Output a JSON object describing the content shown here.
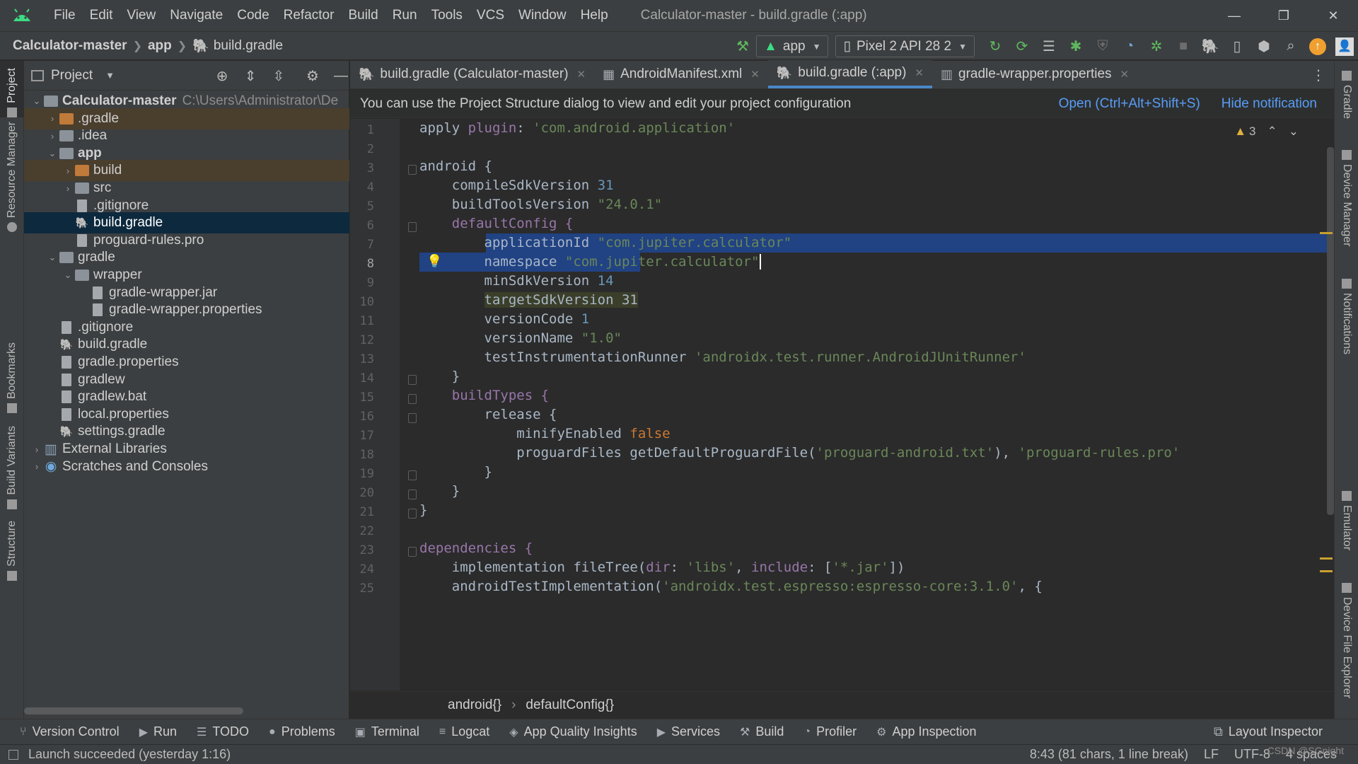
{
  "menu": {
    "items": [
      "File",
      "Edit",
      "View",
      "Navigate",
      "Code",
      "Refactor",
      "Build",
      "Run",
      "Tools",
      "VCS",
      "Window",
      "Help"
    ],
    "window_title": "Calculator-master - build.gradle (:app)"
  },
  "nav": {
    "crumb_project": "Calculator-master",
    "crumb_module": "app",
    "crumb_file": "build.gradle",
    "run_config": "app",
    "device": "Pixel 2 API 28 2"
  },
  "left_strip": {
    "project": "Project",
    "resource_manager": "Resource Manager",
    "bookmarks": "Bookmarks",
    "build_variants": "Build Variants",
    "structure": "Structure"
  },
  "right_strip": {
    "gradle": "Gradle",
    "device_manager": "Device Manager",
    "notifications": "Notifications",
    "emulator": "Emulator",
    "device_file_explorer": "Device File Explorer"
  },
  "project_panel": {
    "title": "Project",
    "root_path": "C:\\Users\\Administrator\\De",
    "tree": [
      {
        "label": "Calculator-master",
        "depth": 0,
        "expanded": true,
        "type": "module",
        "bold": true
      },
      {
        "label": ".gradle",
        "depth": 1,
        "expanded": false,
        "type": "folder-orange",
        "excluded": true
      },
      {
        "label": ".idea",
        "depth": 1,
        "expanded": false,
        "type": "folder"
      },
      {
        "label": "app",
        "depth": 1,
        "expanded": true,
        "type": "module",
        "bold": true
      },
      {
        "label": "build",
        "depth": 2,
        "expanded": false,
        "type": "folder-orange",
        "excluded": true
      },
      {
        "label": "src",
        "depth": 2,
        "expanded": false,
        "type": "folder"
      },
      {
        "label": ".gitignore",
        "depth": 2,
        "type": "file"
      },
      {
        "label": "build.gradle",
        "depth": 2,
        "type": "gradle",
        "selected": true
      },
      {
        "label": "proguard-rules.pro",
        "depth": 2,
        "type": "file"
      },
      {
        "label": "gradle",
        "depth": 1,
        "expanded": true,
        "type": "folder"
      },
      {
        "label": "wrapper",
        "depth": 2,
        "expanded": true,
        "type": "folder"
      },
      {
        "label": "gradle-wrapper.jar",
        "depth": 3,
        "type": "file"
      },
      {
        "label": "gradle-wrapper.properties",
        "depth": 3,
        "type": "file"
      },
      {
        "label": ".gitignore",
        "depth": 1,
        "type": "file"
      },
      {
        "label": "build.gradle",
        "depth": 1,
        "type": "gradle"
      },
      {
        "label": "gradle.properties",
        "depth": 1,
        "type": "file"
      },
      {
        "label": "gradlew",
        "depth": 1,
        "type": "file"
      },
      {
        "label": "gradlew.bat",
        "depth": 1,
        "type": "file"
      },
      {
        "label": "local.properties",
        "depth": 1,
        "type": "file"
      },
      {
        "label": "settings.gradle",
        "depth": 1,
        "type": "gradle"
      },
      {
        "label": "External Libraries",
        "depth": 0,
        "expanded": false,
        "type": "libs"
      },
      {
        "label": "Scratches and Consoles",
        "depth": 0,
        "expanded": false,
        "type": "scratch"
      }
    ]
  },
  "tabs": [
    {
      "label": "build.gradle (Calculator-master)",
      "active": false
    },
    {
      "label": "AndroidManifest.xml",
      "active": false
    },
    {
      "label": "build.gradle (:app)",
      "active": true
    },
    {
      "label": "gradle-wrapper.properties",
      "active": false
    }
  ],
  "banner": {
    "message": "You can use the Project Structure dialog to view and edit your project configuration",
    "open_link": "Open (Ctrl+Alt+Shift+S)",
    "hide_link": "Hide notification"
  },
  "editor": {
    "warning_count": "3",
    "current_line": 8,
    "lines": [
      [
        [
          "apply ",
          "fn"
        ],
        [
          "plugin",
          "p"
        ],
        [
          ": ",
          "fn"
        ],
        [
          "'com.android.application'",
          "s"
        ]
      ],
      [],
      [
        [
          "android {",
          "fn"
        ]
      ],
      [
        [
          "    compileSdkVersion ",
          "fn"
        ],
        [
          "31",
          "n"
        ]
      ],
      [
        [
          "    buildToolsVersion ",
          "fn"
        ],
        [
          "\"24.0.1\"",
          "s"
        ]
      ],
      [
        [
          "    defaultConfig {",
          "p"
        ]
      ],
      [
        [
          "        applicationId ",
          "fn"
        ],
        [
          "\"com.jupiter.calculator\"",
          "s"
        ]
      ],
      [
        [
          "        namespace ",
          "fn"
        ],
        [
          "\"com.jupiter.calculator\"",
          "s"
        ]
      ],
      [
        [
          "        minSdkVersion ",
          "fn"
        ],
        [
          "14",
          "n"
        ]
      ],
      [
        [
          "        ",
          "fn"
        ],
        [
          "targetSdkVersion 31",
          "targ"
        ]
      ],
      [
        [
          "        versionCode ",
          "fn"
        ],
        [
          "1",
          "n"
        ]
      ],
      [
        [
          "        versionName ",
          "fn"
        ],
        [
          "\"1.0\"",
          "s"
        ]
      ],
      [
        [
          "        testInstrumentationRunner ",
          "fn"
        ],
        [
          "'androidx.test.runner.AndroidJUnitRunner'",
          "s"
        ]
      ],
      [
        [
          "    }",
          "fn"
        ]
      ],
      [
        [
          "    buildTypes {",
          "p"
        ]
      ],
      [
        [
          "        release {",
          "fn"
        ]
      ],
      [
        [
          "            minifyEnabled ",
          "fn"
        ],
        [
          "false",
          "k"
        ]
      ],
      [
        [
          "            proguardFiles getDefaultProguardFile(",
          "fn"
        ],
        [
          "'proguard-android.txt'",
          "s"
        ],
        [
          "), ",
          "fn"
        ],
        [
          "'proguard-rules.pro'",
          "s"
        ]
      ],
      [
        [
          "        }",
          "fn"
        ]
      ],
      [
        [
          "    }",
          "fn"
        ]
      ],
      [
        [
          "}",
          "fn"
        ]
      ],
      [],
      [
        [
          "dependencies {",
          "p"
        ]
      ],
      [
        [
          "    implementation fileTree(",
          "fn"
        ],
        [
          "dir",
          "p"
        ],
        [
          ": ",
          "fn"
        ],
        [
          "'libs'",
          "s"
        ],
        [
          ", ",
          "fn"
        ],
        [
          "include",
          "p"
        ],
        [
          ": [",
          "fn"
        ],
        [
          "'*.jar'",
          "s"
        ],
        [
          "])",
          "fn"
        ]
      ],
      [
        [
          "    androidTestImplementation(",
          "fn"
        ],
        [
          "'androidx.test.espresso:espresso-core:3.1.0'",
          "s"
        ],
        [
          ", {",
          "fn"
        ]
      ]
    ]
  },
  "editor_crumbs": {
    "first": "android{}",
    "second": "defaultConfig{}"
  },
  "bottom_tabs": [
    "Version Control",
    "Run",
    "TODO",
    "Problems",
    "Terminal",
    "Logcat",
    "App Quality Insights",
    "Services",
    "Build",
    "Profiler",
    "App Inspection"
  ],
  "bottom_right_tab": "Layout Inspector",
  "status": {
    "message": "Launch succeeded (yesterday 1:16)",
    "position": "8:43 (81 chars, 1 line break)",
    "line_sep": "LF",
    "encoding": "UTF-8",
    "indent": "4 spaces",
    "watermark": "CSDN @SGnight"
  },
  "colors": {
    "accent": "#4a88c7",
    "selection": "#214283",
    "tree_selected": "#0d293e",
    "link": "#589df6"
  }
}
